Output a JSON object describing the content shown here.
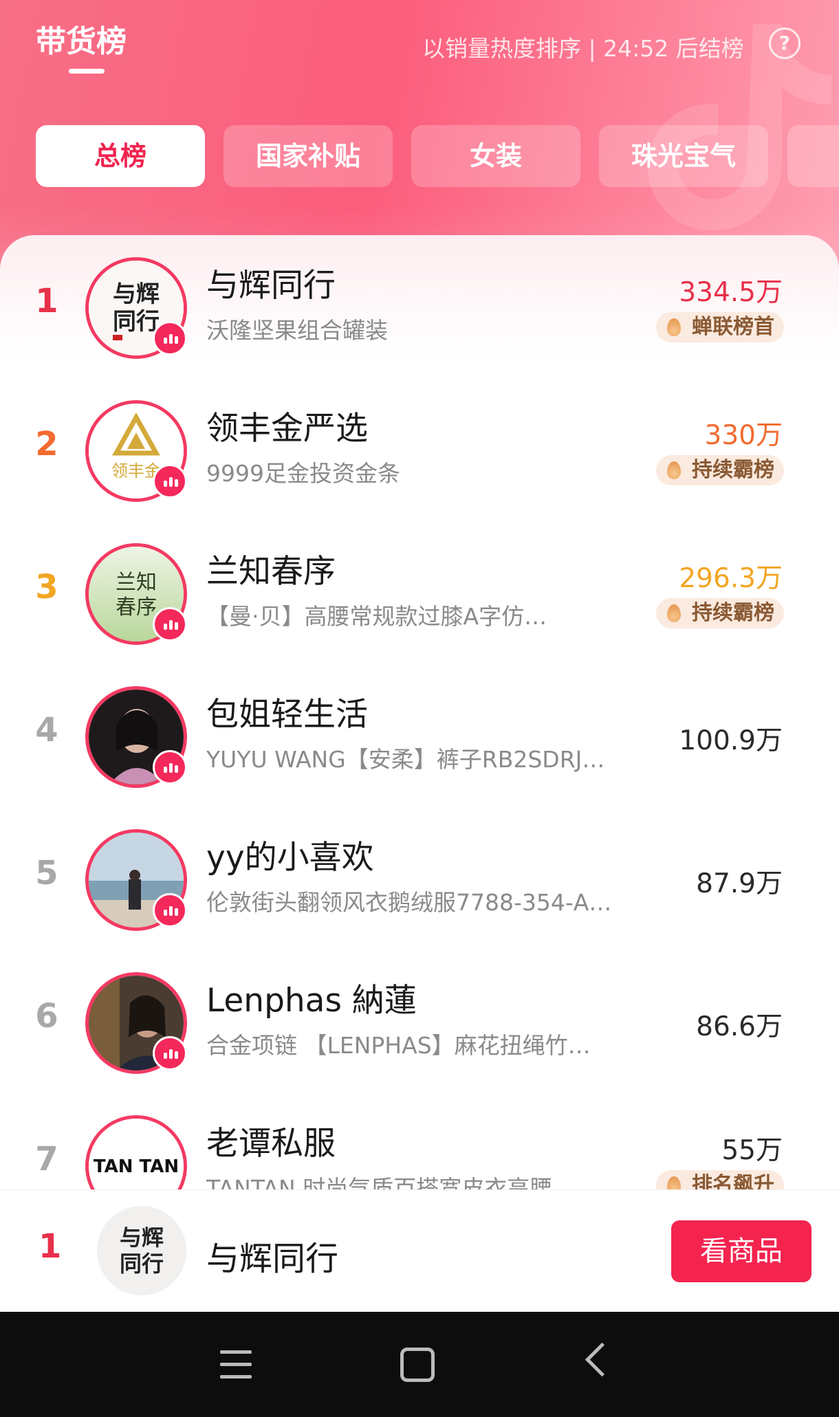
{
  "header": {
    "title": "带货榜",
    "subtitle": "以销量热度排序 | 24:52 后结榜",
    "help_icon": "?"
  },
  "tabs": [
    {
      "label": "总榜",
      "active": true
    },
    {
      "label": "国家补贴",
      "active": false
    },
    {
      "label": "女装",
      "active": false
    },
    {
      "label": "珠光宝气",
      "active": false
    }
  ],
  "ranking": [
    {
      "rank": "1",
      "name": "与辉同行",
      "product": "沃隆坚果组合罐装",
      "sales": "334.5万",
      "tag": "蝉联榜首",
      "rank_color": "#e8304a",
      "sales_color": "#e8304a",
      "avatar_text": "与辉同行"
    },
    {
      "rank": "2",
      "name": "领丰金严选",
      "product": "9999足金投资金条",
      "sales": "330万",
      "tag": "持续霸榜",
      "rank_color": "#f26b2f",
      "sales_color": "#f26b2f",
      "avatar_text": "领丰金"
    },
    {
      "rank": "3",
      "name": "兰知春序",
      "product": "【曼·贝】高腰常规款过膝A字仿…",
      "sales": "296.3万",
      "tag": "持续霸榜",
      "rank_color": "#f2a623",
      "sales_color": "#f2a623",
      "avatar_text": "兰知春序"
    },
    {
      "rank": "4",
      "name": "包姐轻生活",
      "product": "YUYU WANG【安柔】裤子RB2SDRJ…",
      "sales": "100.9万"
    },
    {
      "rank": "5",
      "name": "yy的小喜欢",
      "product": "伦敦街头翻领风衣鹅绒服7788-354-A…",
      "sales": "87.9万"
    },
    {
      "rank": "6",
      "name": "Lenphas 納蓮",
      "product": "合金项链 【LENPHAS】麻花扭绳竹…",
      "sales": "86.6万"
    },
    {
      "rank": "7",
      "name": "老谭私服",
      "product": "TANTAN 时尚气质百搭宽皮衣高腰",
      "sales": "55万",
      "tag": "排名飙升",
      "avatar_text": "TAN TAN"
    }
  ],
  "current": {
    "rank": "1",
    "name": "与辉同行",
    "button_label": "看商品",
    "avatar_text": "与辉同行"
  },
  "colors": {
    "accent": "#f4244f",
    "header_gradient_start": "#f76f86",
    "header_gradient_end": "#ff9fb1"
  },
  "icons": [
    "help-icon",
    "live-indicator-icon",
    "flame-icon",
    "menu-icon",
    "home-icon",
    "back-icon"
  ]
}
